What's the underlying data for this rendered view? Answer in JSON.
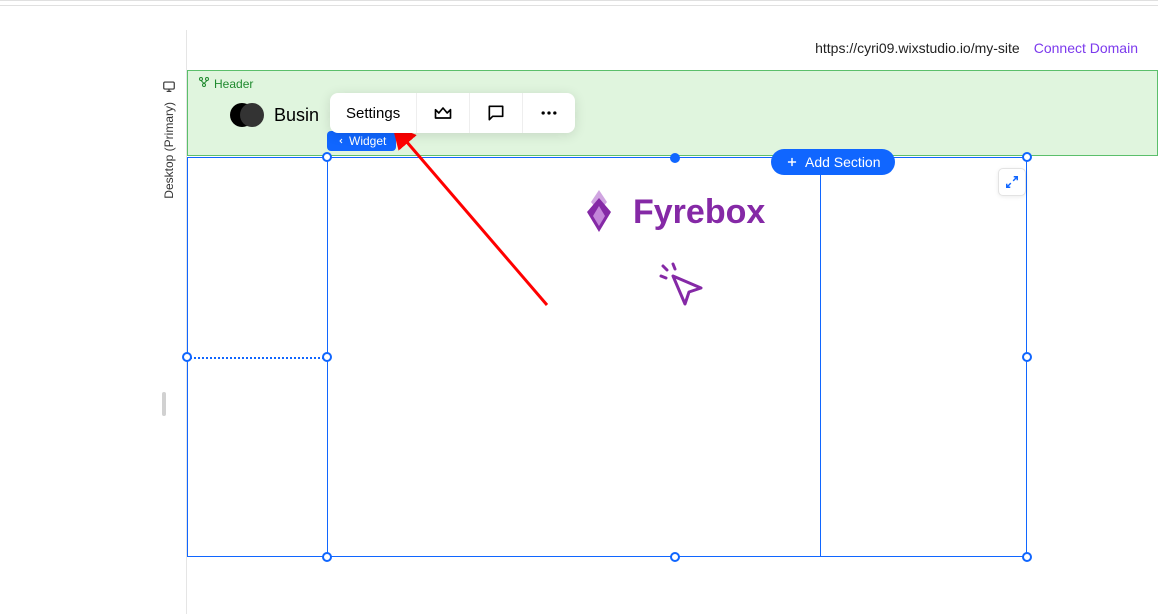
{
  "sidebar": {
    "label": "Desktop (Primary)"
  },
  "urlbar": {
    "url": "https://cyri09.wixstudio.io/my-site",
    "connect": "Connect Domain"
  },
  "header": {
    "label": "Header",
    "brand": "Busin"
  },
  "toolbar": {
    "settings": "Settings"
  },
  "widget_tag": "Widget",
  "add_section": "Add Section",
  "content": {
    "brand": "Fyrebox"
  },
  "colors": {
    "accent_blue": "#1066ff",
    "header_bg": "#e0f5de",
    "header_border": "#5bbf6b",
    "purple": "#8529a6",
    "link_purple": "#7c3aed"
  }
}
